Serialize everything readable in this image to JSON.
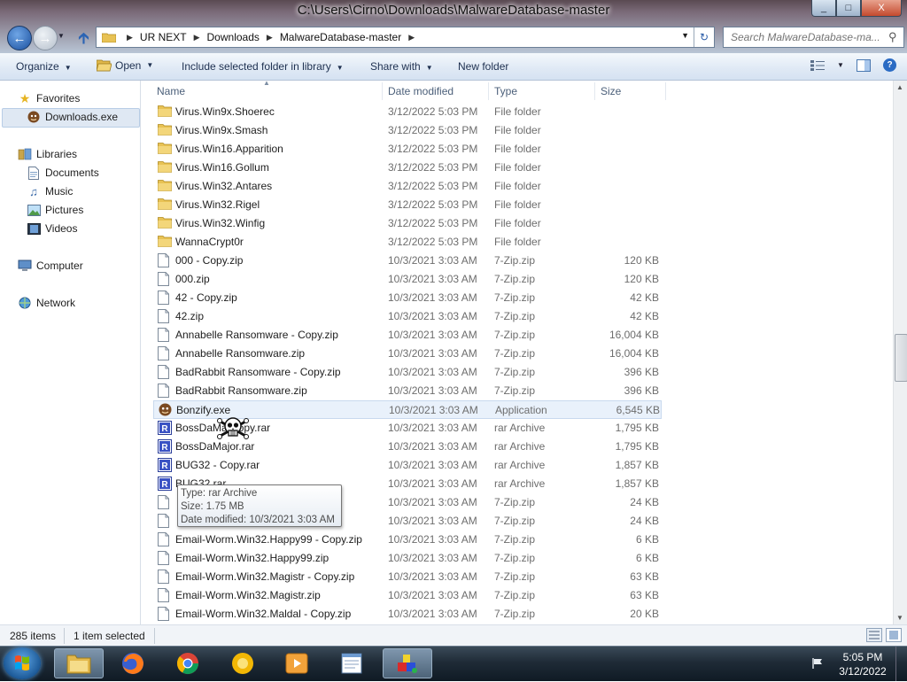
{
  "window": {
    "title": "C:\\Users\\Cirno\\Downloads\\MalwareDatabase-master",
    "controls": [
      "_",
      "□",
      "X"
    ]
  },
  "address": {
    "crumbs": [
      "UR NEXT",
      "Downloads",
      "MalwareDatabase-master"
    ]
  },
  "search": {
    "placeholder": "Search MalwareDatabase-ma..."
  },
  "toolbar": {
    "organize": "Organize",
    "open": "Open",
    "include": "Include selected folder in library",
    "share": "Share with",
    "newfolder": "New folder"
  },
  "nav": {
    "favorites": "Favorites",
    "fav_item": "Downloads.exe",
    "libraries": "Libraries",
    "documents": "Documents",
    "music": "Music",
    "pictures": "Pictures",
    "videos": "Videos",
    "computer": "Computer",
    "network": "Network"
  },
  "columns": {
    "name": "Name",
    "date": "Date modified",
    "type": "Type",
    "size": "Size"
  },
  "files": [
    {
      "name": "Virus.Win9x.Shoerec",
      "date": "3/12/2022 5:03 PM",
      "type": "File folder",
      "size": "",
      "icon": "folder"
    },
    {
      "name": "Virus.Win9x.Smash",
      "date": "3/12/2022 5:03 PM",
      "type": "File folder",
      "size": "",
      "icon": "folder"
    },
    {
      "name": "Virus.Win16.Apparition",
      "date": "3/12/2022 5:03 PM",
      "type": "File folder",
      "size": "",
      "icon": "folder"
    },
    {
      "name": "Virus.Win16.Gollum",
      "date": "3/12/2022 5:03 PM",
      "type": "File folder",
      "size": "",
      "icon": "folder"
    },
    {
      "name": "Virus.Win32.Antares",
      "date": "3/12/2022 5:03 PM",
      "type": "File folder",
      "size": "",
      "icon": "folder"
    },
    {
      "name": "Virus.Win32.Rigel",
      "date": "3/12/2022 5:03 PM",
      "type": "File folder",
      "size": "",
      "icon": "folder"
    },
    {
      "name": "Virus.Win32.Winfig",
      "date": "3/12/2022 5:03 PM",
      "type": "File folder",
      "size": "",
      "icon": "folder"
    },
    {
      "name": "WannaCrypt0r",
      "date": "3/12/2022 5:03 PM",
      "type": "File folder",
      "size": "",
      "icon": "folder"
    },
    {
      "name": "000 - Copy.zip",
      "date": "10/3/2021 3:03 AM",
      "type": "7-Zip.zip",
      "size": "120 KB",
      "icon": "file"
    },
    {
      "name": "000.zip",
      "date": "10/3/2021 3:03 AM",
      "type": "7-Zip.zip",
      "size": "120 KB",
      "icon": "file"
    },
    {
      "name": "42 - Copy.zip",
      "date": "10/3/2021 3:03 AM",
      "type": "7-Zip.zip",
      "size": "42 KB",
      "icon": "file"
    },
    {
      "name": "42.zip",
      "date": "10/3/2021 3:03 AM",
      "type": "7-Zip.zip",
      "size": "42 KB",
      "icon": "file"
    },
    {
      "name": "Annabelle Ransomware - Copy.zip",
      "date": "10/3/2021 3:03 AM",
      "type": "7-Zip.zip",
      "size": "16,004 KB",
      "icon": "file"
    },
    {
      "name": "Annabelle Ransomware.zip",
      "date": "10/3/2021 3:03 AM",
      "type": "7-Zip.zip",
      "size": "16,004 KB",
      "icon": "file"
    },
    {
      "name": "BadRabbit Ransomware - Copy.zip",
      "date": "10/3/2021 3:03 AM",
      "type": "7-Zip.zip",
      "size": "396 KB",
      "icon": "file"
    },
    {
      "name": "BadRabbit Ransomware.zip",
      "date": "10/3/2021 3:03 AM",
      "type": "7-Zip.zip",
      "size": "396 KB",
      "icon": "file"
    },
    {
      "name": "Bonzify.exe",
      "date": "10/3/2021 3:03 AM",
      "type": "Application",
      "size": "6,545 KB",
      "icon": "app"
    },
    {
      "name": "BossDaMa     Copy.rar",
      "date": "10/3/2021 3:03 AM",
      "type": "rar Archive",
      "size": "1,795 KB",
      "icon": "rar"
    },
    {
      "name": "BossDaMajor.rar",
      "date": "10/3/2021 3:03 AM",
      "type": "rar Archive",
      "size": "1,795 KB",
      "icon": "rar"
    },
    {
      "name": "BUG32 - Copy.rar",
      "date": "10/3/2021 3:03 AM",
      "type": "rar Archive",
      "size": "1,857 KB",
      "icon": "rar"
    },
    {
      "name": "BUG32.rar",
      "date": "10/3/2021 3:03 AM",
      "type": "rar Archive",
      "size": "1,857 KB",
      "icon": "rar"
    },
    {
      "name": "",
      "date": "10/3/2021 3:03 AM",
      "type": "7-Zip.zip",
      "size": "24 KB",
      "icon": "file"
    },
    {
      "name": "",
      "date": "10/3/2021 3:03 AM",
      "type": "7-Zip.zip",
      "size": "24 KB",
      "icon": "file"
    },
    {
      "name": "Email-Worm.Win32.Happy99 - Copy.zip",
      "date": "10/3/2021 3:03 AM",
      "type": "7-Zip.zip",
      "size": "6 KB",
      "icon": "file"
    },
    {
      "name": "Email-Worm.Win32.Happy99.zip",
      "date": "10/3/2021 3:03 AM",
      "type": "7-Zip.zip",
      "size": "6 KB",
      "icon": "file"
    },
    {
      "name": "Email-Worm.Win32.Magistr - Copy.zip",
      "date": "10/3/2021 3:03 AM",
      "type": "7-Zip.zip",
      "size": "63 KB",
      "icon": "file"
    },
    {
      "name": "Email-Worm.Win32.Magistr.zip",
      "date": "10/3/2021 3:03 AM",
      "type": "7-Zip.zip",
      "size": "63 KB",
      "icon": "file"
    },
    {
      "name": "Email-Worm.Win32.Maldal - Copy.zip",
      "date": "10/3/2021 3:03 AM",
      "type": "7-Zip.zip",
      "size": "20 KB",
      "icon": "file"
    }
  ],
  "selected_index": 16,
  "tooltip": {
    "type": "Type: rar Archive",
    "size": "Size: 1.75 MB",
    "date": "Date modified: 10/3/2021 3:03 AM"
  },
  "status": {
    "count": "285 items",
    "selected": "1 item selected"
  },
  "taskbar": {
    "time": "5:05 PM",
    "date": "3/12/2022"
  }
}
